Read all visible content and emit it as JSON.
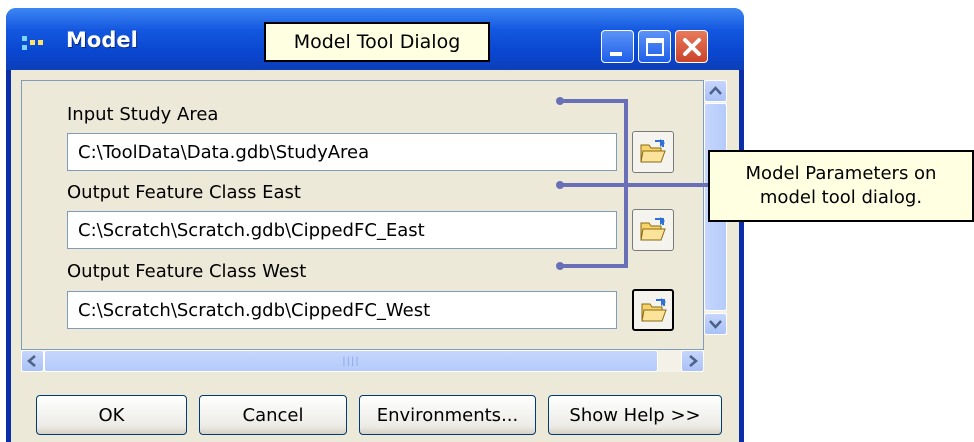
{
  "window": {
    "title": "Model",
    "title_callout": "Model Tool Dialog"
  },
  "title_buttons": {
    "minimize": "minimize-icon",
    "maximize": "maximize-icon",
    "close": "close-icon"
  },
  "parameters": [
    {
      "label": "Input Study Area",
      "value": "C:\\ToolData\\Data.gdb\\StudyArea"
    },
    {
      "label": "Output Feature Class East",
      "value": "C:\\Scratch\\Scratch.gdb\\CippedFC_East"
    },
    {
      "label": "Output Feature Class West",
      "value": "C:\\Scratch\\Scratch.gdb\\CippedFC_West"
    }
  ],
  "buttons": {
    "ok": "OK",
    "cancel": "Cancel",
    "environments": "Environments...",
    "show_help": "Show Help >>"
  },
  "annotation": {
    "line1": "Model Parameters on",
    "line2": "model tool dialog."
  },
  "colors": {
    "titlebar": "#0a47d1",
    "callout_bg": "#ffffe1",
    "connector": "#6a70b8",
    "dialog_bg": "#ece9d8"
  }
}
